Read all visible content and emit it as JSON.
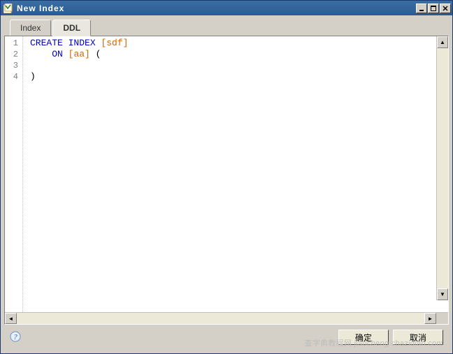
{
  "window": {
    "title": "New Index"
  },
  "tabs": {
    "index": "Index",
    "ddl": "DDL"
  },
  "editor": {
    "lines": [
      "1",
      "2",
      "3",
      "4"
    ],
    "code": {
      "line1": {
        "kw1": "CREATE",
        "kw2": "INDEX",
        "ident": "[sdf]"
      },
      "line2": {
        "kw": "ON",
        "ident": "[aa]",
        "tail": " ("
      },
      "line3": "",
      "line4": ")"
    }
  },
  "footer": {
    "ok": "确定",
    "cancel": "取消"
  },
  "watermark": "查字典教程网 jiaocheng.chazidian.com"
}
